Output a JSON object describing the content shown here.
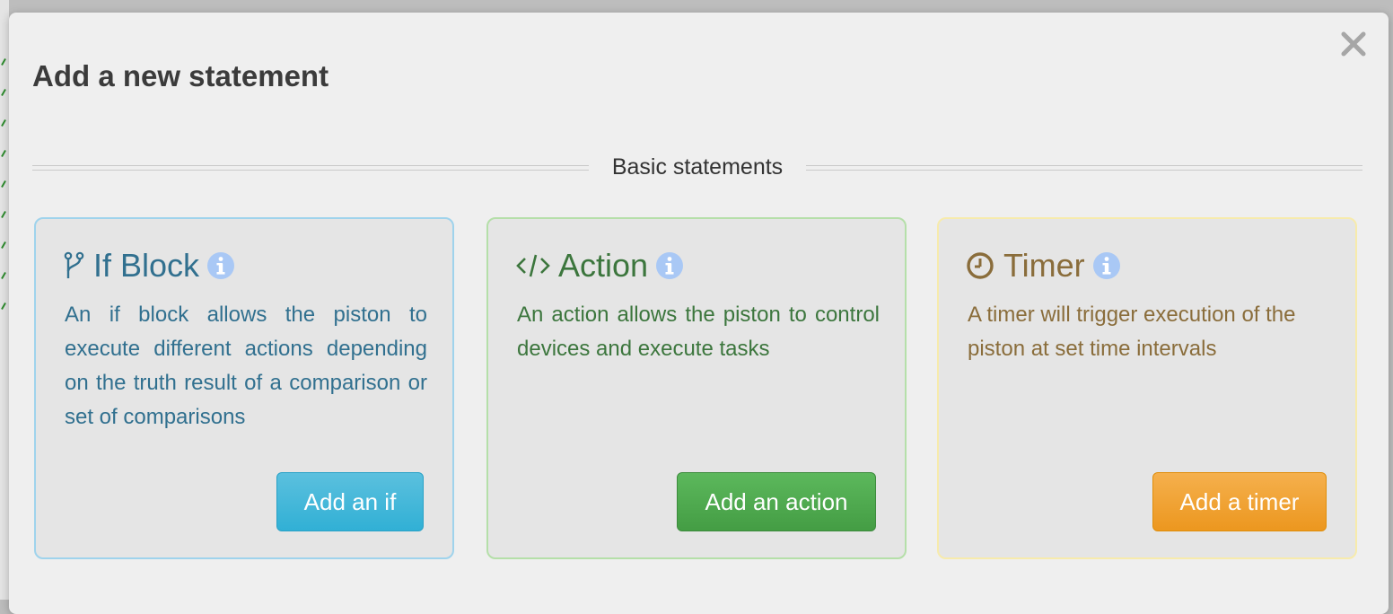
{
  "modal": {
    "title": "Add a new statement",
    "section_label": "Basic statements"
  },
  "icons": {
    "close": "close-icon",
    "if": "branch-icon",
    "action": "code-icon",
    "timer": "clock-icon",
    "info": "info-icon"
  },
  "colors": {
    "if_accent": "#31708f",
    "action_accent": "#3c763d",
    "timer_accent": "#8a6d3b",
    "info_badge": "#a9c8f5",
    "btn_if": "#31b0d5",
    "btn_action": "#449d44",
    "btn_timer": "#ec971f"
  },
  "cards": [
    {
      "title": "If Block",
      "description": "An if block allows the piston to execute different actions depending on the truth result of a comparison or set of comparisons",
      "button": "Add an if"
    },
    {
      "title": "Action",
      "description": "An action allows the piston to control devices and execute tasks",
      "button": "Add an action"
    },
    {
      "title": "Timer",
      "description": "A timer will trigger execution of the piston at set time intervals",
      "button": "Add a timer"
    }
  ]
}
